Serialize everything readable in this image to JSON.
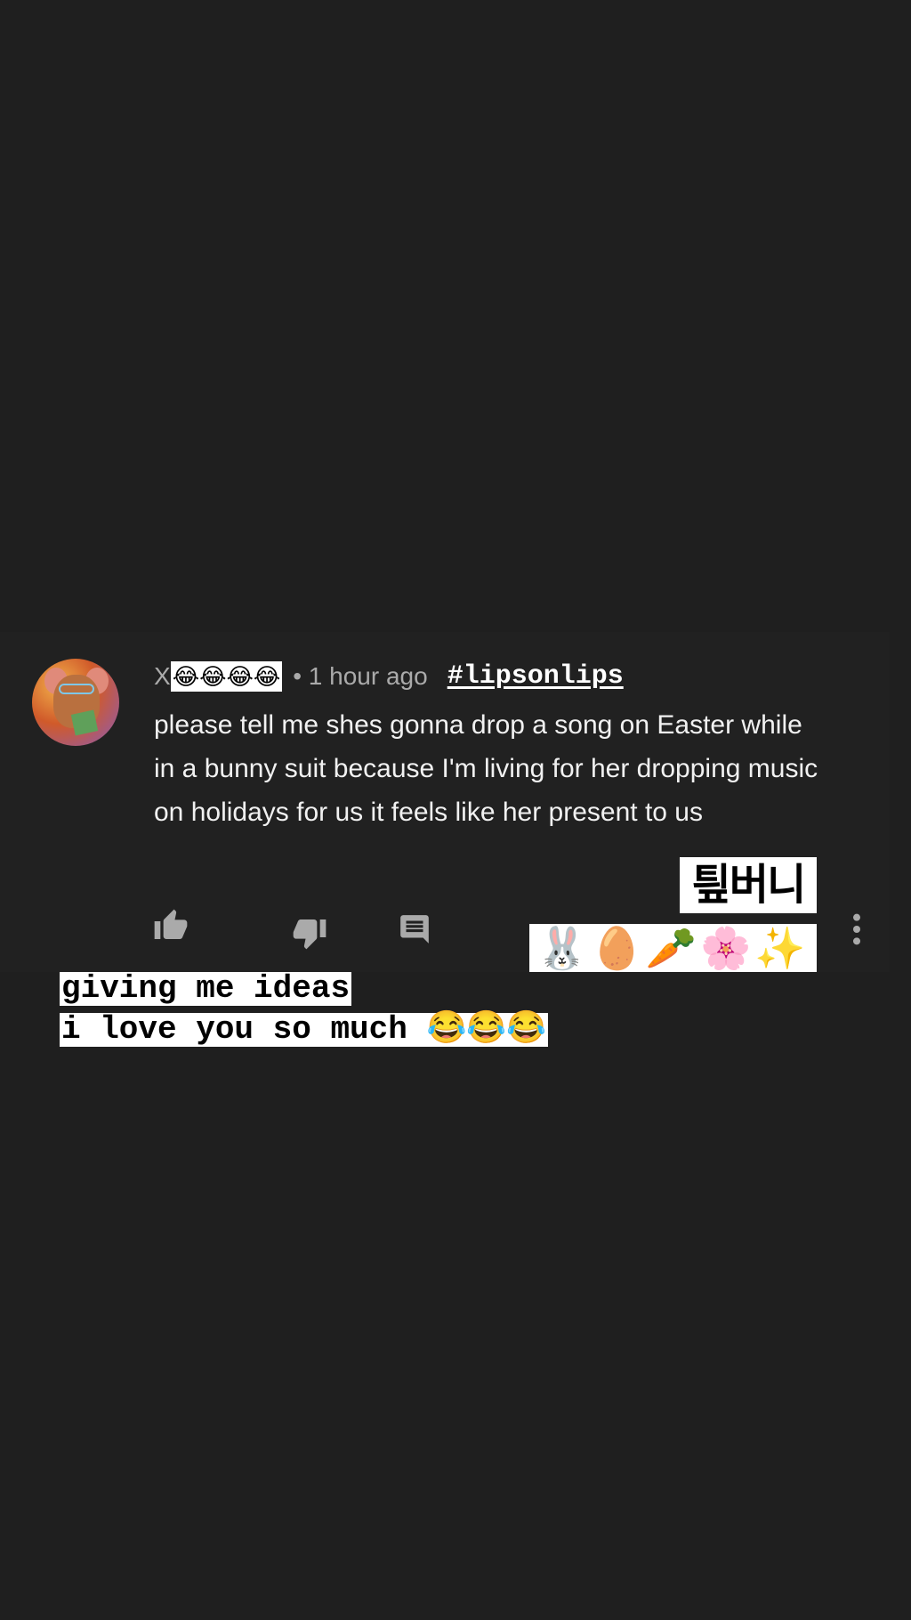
{
  "comment": {
    "username": "X",
    "username_sticker": "😂😂😂😂",
    "time": "• 1 hour ago",
    "hashtag": "#lipsonlips",
    "text": "please tell me shes gonna drop a song on Easter while in a bunny suit because I'm living for her dropping music on holidays for us it feels like her present to us"
  },
  "actions": {
    "like_icon": "thumbs-up-icon",
    "dislike_icon": "thumbs-down-icon",
    "reply_icon": "comment-icon",
    "more_icon": "more-vertical-icon"
  },
  "stickers": {
    "korean": "틮버니",
    "emoji": "🐰🥚🥕🌸✨"
  },
  "captions": {
    "line1": "giving me ideas",
    "line2": "i love you so much 😂😂😂"
  },
  "colors": {
    "background": "#1f1f1f",
    "card": "#212121",
    "icon_gray": "#aaaaaa",
    "text": "#f1f1f1"
  }
}
